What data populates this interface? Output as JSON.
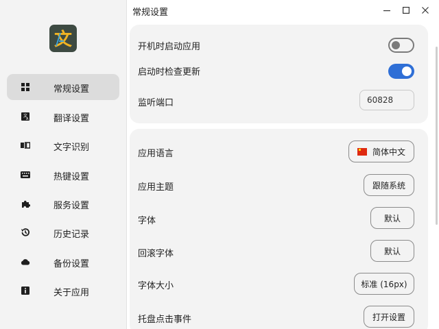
{
  "window": {
    "title": "常规设置",
    "controls": [
      "minimize-icon",
      "maximize-icon",
      "close-icon"
    ]
  },
  "app": {
    "logo_glyph": "文",
    "logo_colors": [
      "#3d4a42",
      "#f0b323",
      "#3aa0d8"
    ]
  },
  "sidebar": {
    "items": [
      {
        "label": "常规设置",
        "icon": "grid-icon",
        "active": true
      },
      {
        "label": "翻译设置",
        "icon": "translate-icon",
        "active": false
      },
      {
        "label": "文字识别",
        "icon": "ocr-icon",
        "active": false
      },
      {
        "label": "热键设置",
        "icon": "keyboard-icon",
        "active": false
      },
      {
        "label": "服务设置",
        "icon": "puzzle-icon",
        "active": false
      },
      {
        "label": "历史记录",
        "icon": "history-icon",
        "active": false
      },
      {
        "label": "备份设置",
        "icon": "cloud-icon",
        "active": false
      },
      {
        "label": "关于应用",
        "icon": "info-icon",
        "active": false
      }
    ]
  },
  "card1": {
    "autostart": {
      "label": "开机时启动应用",
      "enabled": false
    },
    "check_update": {
      "label": "启动时检查更新",
      "enabled": true
    },
    "port": {
      "label": "监听端口",
      "value": "60828"
    }
  },
  "card2": {
    "language": {
      "label": "应用语言",
      "value": "简体中文"
    },
    "theme": {
      "label": "应用主题",
      "value": "跟随系统"
    },
    "font": {
      "label": "字体",
      "value": "默认"
    },
    "fallback_font": {
      "label": "回滚字体",
      "value": "默认"
    },
    "font_size": {
      "label": "字体大小",
      "value": "标准 (16px)"
    },
    "tray_click": {
      "label": "托盘点击事件",
      "value": "打开设置"
    }
  },
  "colors": {
    "accent": "#2f6fd6",
    "flag_red": "#de2910"
  }
}
